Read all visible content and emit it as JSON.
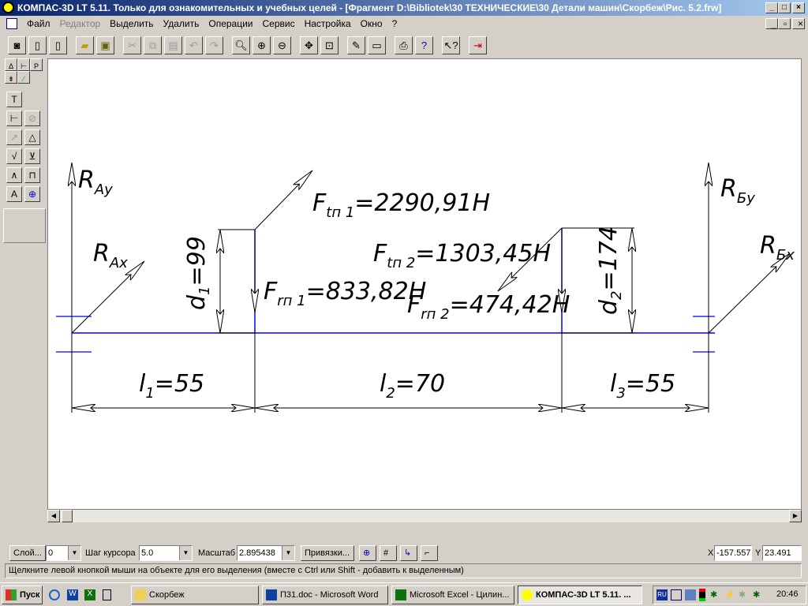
{
  "title": "КОМПАС-3D LT 5.11. Только для ознакомительных и учебных целей - [Фрагмент D:\\Bibliotek\\30 ТЕХНИЧЕСКИЕ\\30 Детали машин\\Скорбеж\\Рис. 5.2.frw]",
  "menu": [
    "Файл",
    "Редактор",
    "Выделить",
    "Удалить",
    "Операции",
    "Сервис",
    "Настройка",
    "Окно",
    "?"
  ],
  "drawing": {
    "RAy": "R",
    "RAy_sub": "Ay",
    "RAx": "R",
    "RAx_sub": "Ax",
    "RBy": "R",
    "RBy_sub": "Бy",
    "RBx": "R",
    "RBx_sub": "Бx",
    "Ft1": "F",
    "Ft1_sub": "tп 1",
    "Ft1_val": "=2290,91H",
    "Fr1": "F",
    "Fr1_sub": "rп 1",
    "Fr1_val": "=833,82H",
    "Ft2": "F",
    "Ft2_sub": "tп 2",
    "Ft2_val": "=1303,45H",
    "Fr2": "F",
    "Fr2_sub": "rп 2",
    "Fr2_val": "=474,42H",
    "d1": "d",
    "d1_sub": "1",
    "d1_val": "=99",
    "d2": "d",
    "d2_sub": "2",
    "d2_val": "=174",
    "l1": "l",
    "l1_sub": "1",
    "l1_val": "=55",
    "l2": "l",
    "l2_sub": "2",
    "l2_val": "=70",
    "l3": "l",
    "l3_sub": "3",
    "l3_val": "=55"
  },
  "controls": {
    "layer_btn": "Слой...",
    "layer": "0",
    "step_label": "Шаг курсора",
    "step": "5.0",
    "scale_label": "Масштаб",
    "scale": "2.895438",
    "snap_btn": "Привязки...",
    "x_label": "X",
    "x": "-157.557",
    "y_label": "Y",
    "y": "23.491"
  },
  "status": "Щелкните левой кнопкой мыши на объекте для его выделения (вместе с Ctrl или Shift - добавить к выделенным)",
  "taskbar": {
    "start": "Пуск",
    "tasks": [
      "Скорбеж",
      "П31.doc - Microsoft Word",
      "Microsoft Excel - Цилин...",
      "КОМПАС-3D LT 5.11. ..."
    ],
    "lang": "RU",
    "clock": "20:46"
  },
  "colors": {
    "axis": "#0000ff",
    "line": "#000000"
  }
}
